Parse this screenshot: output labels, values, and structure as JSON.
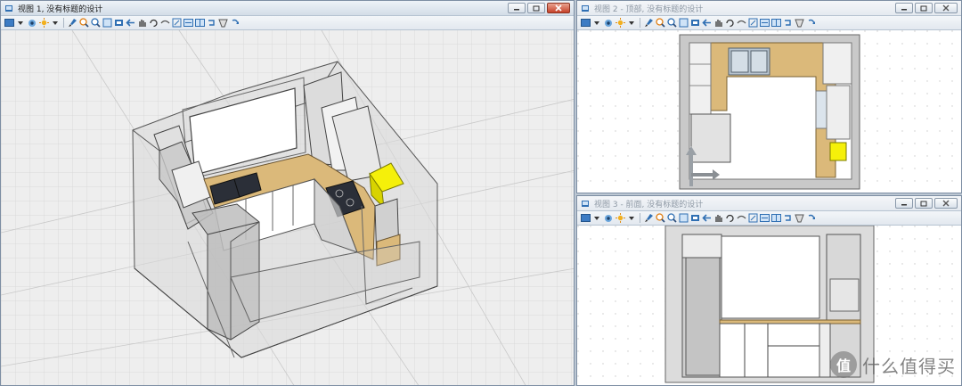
{
  "colors": {
    "accent_yellow": "#f5f00a",
    "countertop": "#dbb97a",
    "selection_blue": "#2f6fb3"
  },
  "window1": {
    "title": "视图 1, 没有标题的设计"
  },
  "window2": {
    "title": "视图 2 - 顶部, 没有标题的设计"
  },
  "window3": {
    "title": "视图 3 - 前面, 没有标题的设计"
  },
  "toolbar_icons": [
    "view-select-icon",
    "dropdown-icon",
    "eye-icon",
    "sun-icon",
    "dropdown-icon",
    "brush-icon",
    "zoom-in-icon",
    "zoom-out-icon",
    "zoom-window-icon",
    "zoom-extents-icon",
    "previous-view-icon",
    "pan-icon",
    "rotate-icon",
    "walk-icon",
    "fit-selection-icon",
    "layout-icon",
    "layout-icon",
    "undo-view-icon",
    "perspective-icon",
    "redo-view-icon"
  ],
  "watermark": {
    "text": "什么值得买",
    "glyph": "值"
  }
}
